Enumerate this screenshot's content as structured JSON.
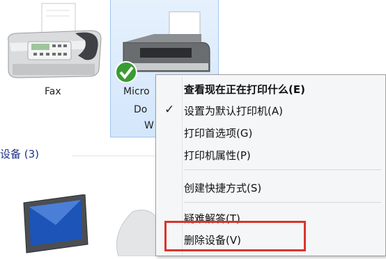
{
  "devices": {
    "fax": {
      "label": "Fax"
    },
    "printer": {
      "label_lines": [
        "Micro",
        "Do",
        "W"
      ]
    }
  },
  "section": {
    "heading": "设备 (3)"
  },
  "context_menu": {
    "items": [
      {
        "label": "查看现在正在打印什么(E)",
        "bold": true
      },
      {
        "label": "设置为默认打印机(A)",
        "checked": true
      },
      {
        "label": "打印首选项(G)"
      },
      {
        "label": "打印机属性(P)"
      },
      {
        "label": "创建快捷方式(S)"
      },
      {
        "label": "疑难解答(T)"
      },
      {
        "label": "删除设备(V)",
        "highlighted": true
      }
    ]
  },
  "colors": {
    "highlight_box": "#d9342b",
    "selection_tile": "#d3e6fb"
  }
}
